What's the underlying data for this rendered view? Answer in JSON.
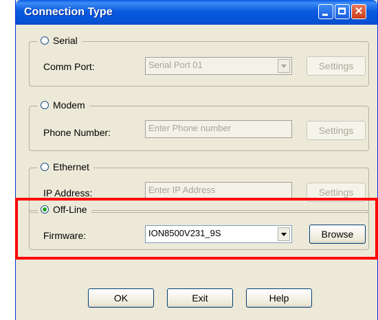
{
  "window": {
    "title": "Connection Type",
    "controls": [
      "minimize-icon",
      "maximize-icon",
      "close-icon"
    ],
    "close_glyph": "✕"
  },
  "serial": {
    "label": "Serial",
    "selected": false,
    "field_label": "Comm Port:",
    "value": "Serial Port 01",
    "settings_label": "Settings"
  },
  "modem": {
    "label": "Modem",
    "selected": false,
    "field_label": "Phone Number:",
    "placeholder": "Enter Phone number",
    "settings_label": "Settings"
  },
  "ethernet": {
    "label": "Ethernet",
    "selected": false,
    "field_label": "IP Address:",
    "placeholder": "Enter IP Address",
    "settings_label": "Settings"
  },
  "offline": {
    "label": "Off-Line",
    "selected": true,
    "field_label": "Firmware:",
    "value": "ION8500V231_9S",
    "browse_label": "Browse"
  },
  "footer": {
    "ok_label": "OK",
    "exit_label": "Exit",
    "help_label": "Help"
  },
  "colors": {
    "highlight": "#ff0000",
    "titlebar": "#0a5ae0",
    "dialog_bg": "#ece9d8"
  }
}
